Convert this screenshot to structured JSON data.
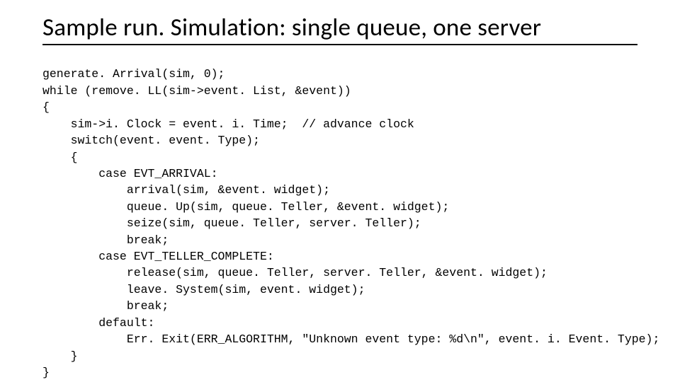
{
  "title": "Sample run. Simulation: single queue, one server",
  "code": {
    "l01": "generate. Arrival(sim, 0);",
    "l02": "while (remove. LL(sim->event. List, &event))",
    "l03": "{",
    "l04": "    sim->i. Clock = event. i. Time;  // advance clock",
    "l05": "    switch(event. event. Type);",
    "l06": "    {",
    "l07": "        case EVT_ARRIVAL:",
    "l08": "            arrival(sim, &event. widget);",
    "l09": "            queue. Up(sim, queue. Teller, &event. widget);",
    "l10": "            seize(sim, queue. Teller, server. Teller);",
    "l11": "            break;",
    "l12": "        case EVT_TELLER_COMPLETE:",
    "l13": "            release(sim, queue. Teller, server. Teller, &event. widget);",
    "l14": "            leave. System(sim, event. widget);",
    "l15": "            break;",
    "l16": "        default:",
    "l17": "            Err. Exit(ERR_ALGORITHM, \"Unknown event type: %d\\n\", event. i. Event. Type);",
    "l18": "    }",
    "l19": "}"
  }
}
